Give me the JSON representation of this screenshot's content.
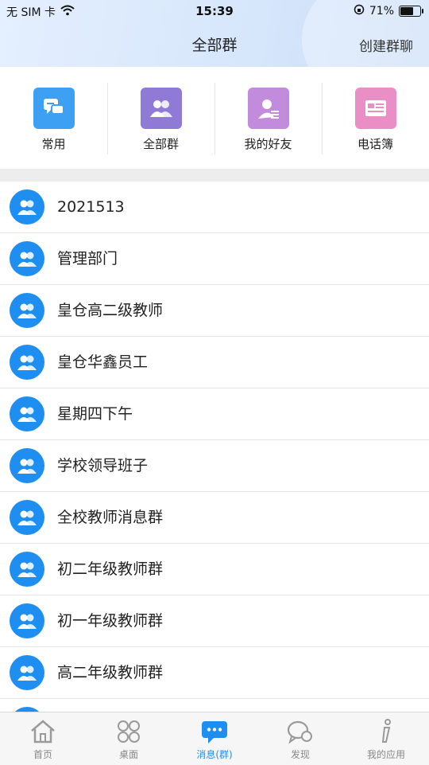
{
  "status": {
    "carrier": "无 SIM 卡",
    "time": "15:39",
    "battery": "71%",
    "battery_level": 0.71
  },
  "header": {
    "title": "全部群",
    "action": "创建群聊"
  },
  "quick": [
    {
      "label": "常用",
      "icon": "chat-bubbles-icon",
      "color": "#3ea0f2"
    },
    {
      "label": "全部群",
      "icon": "group-icon",
      "color": "#8f7bd6"
    },
    {
      "label": "我的好友",
      "icon": "friend-icon",
      "color": "#c38bdb"
    },
    {
      "label": "电话簿",
      "icon": "phonebook-icon",
      "color": "#ea8fc6"
    }
  ],
  "groups": [
    "2021513",
    "管理部门",
    "皇仓高二级教师",
    "皇仓华鑫员工",
    "星期四下午",
    "学校领导班子",
    "全校教师消息群",
    "初二年级教师群",
    "初一年级教师群",
    "高二年级教师群",
    ""
  ],
  "tabs": [
    {
      "label": "首页",
      "icon": "home-icon"
    },
    {
      "label": "桌面",
      "icon": "desktop-grid-icon"
    },
    {
      "label": "消息(群)",
      "icon": "message-icon",
      "active": true
    },
    {
      "label": "发现",
      "icon": "discover-icon"
    },
    {
      "label": "我的应用",
      "icon": "info-icon"
    }
  ],
  "colors": {
    "accent": "#1e8ef0",
    "header_bg": "#d6e6fb"
  }
}
